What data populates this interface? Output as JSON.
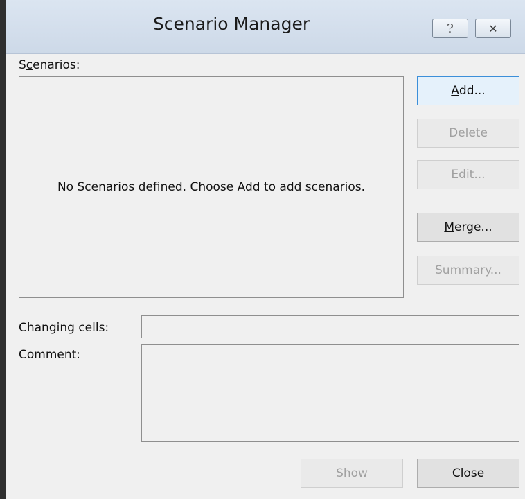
{
  "window": {
    "title": "Scenario Manager",
    "help_icon_glyph": "?",
    "close_icon_glyph": "✕"
  },
  "scenarios": {
    "label_pre": "S",
    "label_access_key": "c",
    "label_post": "enarios:",
    "empty_message": "No Scenarios defined. Choose Add to add scenarios."
  },
  "buttons": {
    "add": {
      "key": "A",
      "rest": "dd..."
    },
    "delete": {
      "label": "Delete"
    },
    "edit": {
      "label": "Edit..."
    },
    "merge": {
      "key": "M",
      "rest": "erge..."
    },
    "summary": {
      "label": "Summary..."
    },
    "show": {
      "label": "Show"
    },
    "close": {
      "label": "Close"
    }
  },
  "fields": {
    "changing_cells_label": "Changing cells:",
    "changing_cells_value": "",
    "comment_label": "Comment:",
    "comment_value": ""
  },
  "colors": {
    "title_bar": "#cdd9e8",
    "dialog_bg": "#f0f0f0",
    "default_button_border": "#3c8fd9",
    "disabled_text": "#a0a0a0"
  }
}
